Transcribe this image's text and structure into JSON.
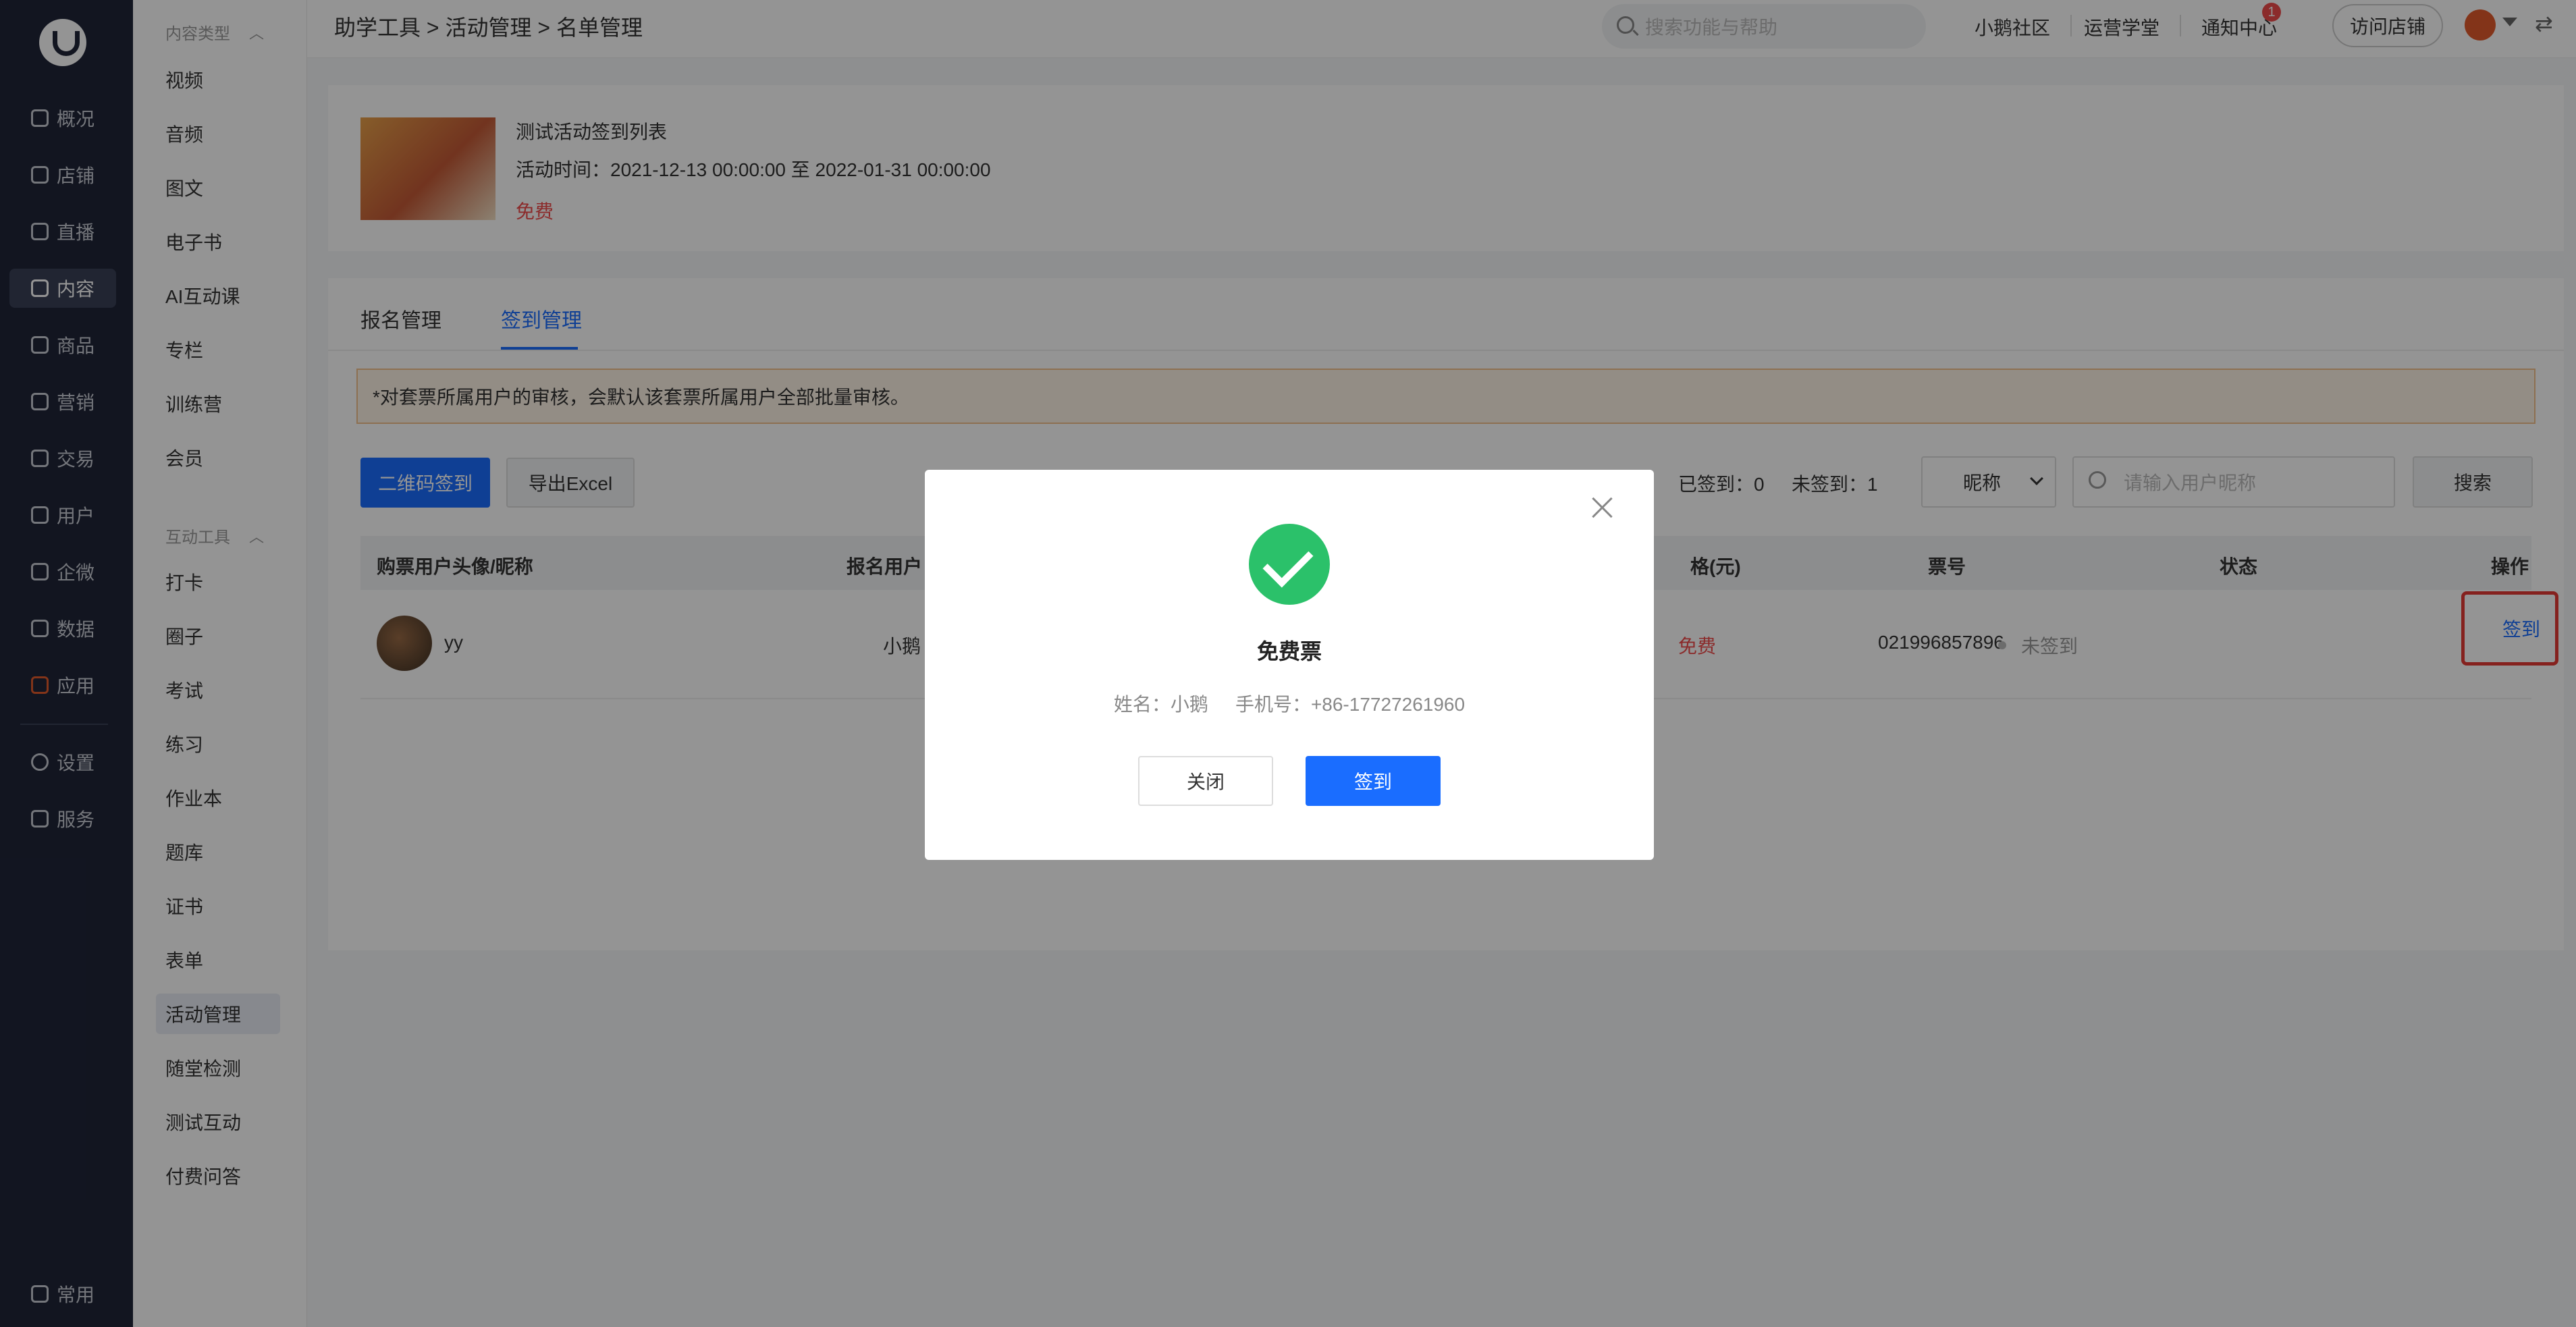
{
  "sidebar": {
    "items": [
      {
        "label": "概况",
        "icon": "overview-icon"
      },
      {
        "label": "店铺",
        "icon": "store-icon"
      },
      {
        "label": "直播",
        "icon": "live-icon"
      },
      {
        "label": "内容",
        "icon": "content-icon"
      },
      {
        "label": "商品",
        "icon": "goods-icon"
      },
      {
        "label": "营销",
        "icon": "marketing-icon"
      },
      {
        "label": "交易",
        "icon": "trade-icon"
      },
      {
        "label": "用户",
        "icon": "user-icon"
      },
      {
        "label": "企微",
        "icon": "wecom-icon"
      },
      {
        "label": "数据",
        "icon": "data-icon"
      },
      {
        "label": "应用",
        "icon": "apps-icon"
      },
      {
        "label": "设置",
        "icon": "settings-icon"
      },
      {
        "label": "服务",
        "icon": "service-icon"
      }
    ],
    "bottom": "常用"
  },
  "subnav": {
    "group1": "内容类型",
    "group1_items": [
      "视频",
      "音频",
      "图文",
      "电子书",
      "AI互动课",
      "专栏",
      "训练营",
      "会员"
    ],
    "group2": "互动工具",
    "group2_items": [
      "打卡",
      "圈子",
      "考试",
      "练习",
      "作业本",
      "题库",
      "证书",
      "表单",
      "活动管理",
      "随堂检测",
      "测试互动",
      "付费问答"
    ]
  },
  "topbar": {
    "breadcrumb": "助学工具 > 活动管理 > 名单管理",
    "search_placeholder": "搜索功能与帮助",
    "links": [
      "小鹅社区",
      "运营学堂",
      "通知中心"
    ],
    "notify_count": "1",
    "visit_store": "访问店铺"
  },
  "activity": {
    "title": "测试活动签到列表",
    "time": "活动时间：2021-12-13 00:00:00 至 2022-01-31 00:00:00",
    "price": "免费"
  },
  "tabs": [
    "报名管理",
    "签到管理"
  ],
  "notice": "*对套票所属用户的审核，会默认该套票所属用户全部批量审核。",
  "toolbar": {
    "qr_sign": "二维码签到",
    "export": "导出Excel",
    "signed": "已签到：0",
    "unsigned": "未签到：1",
    "select_value": "昵称",
    "input_placeholder": "请输入用户昵称",
    "search": "搜索"
  },
  "table": {
    "headers": [
      "购票用户头像/昵称",
      "报名用户",
      "格(元)",
      "票号",
      "状态",
      "操作"
    ],
    "rows": [
      {
        "nickname": "yy",
        "reg_user": "小鹅",
        "price": "免费",
        "ticket_no": "021996857896",
        "status": "未签到",
        "action": "签到"
      }
    ]
  },
  "modal": {
    "title": "免费票",
    "name": "姓名：小鹅",
    "phone": "手机号：+86-17727261960",
    "close_label": "关闭",
    "sign_label": "签到"
  },
  "colors": {
    "accent": "#1a6dff",
    "danger": "#f04b4b",
    "success": "#2bc16a",
    "sidebar": "#1f2538"
  }
}
